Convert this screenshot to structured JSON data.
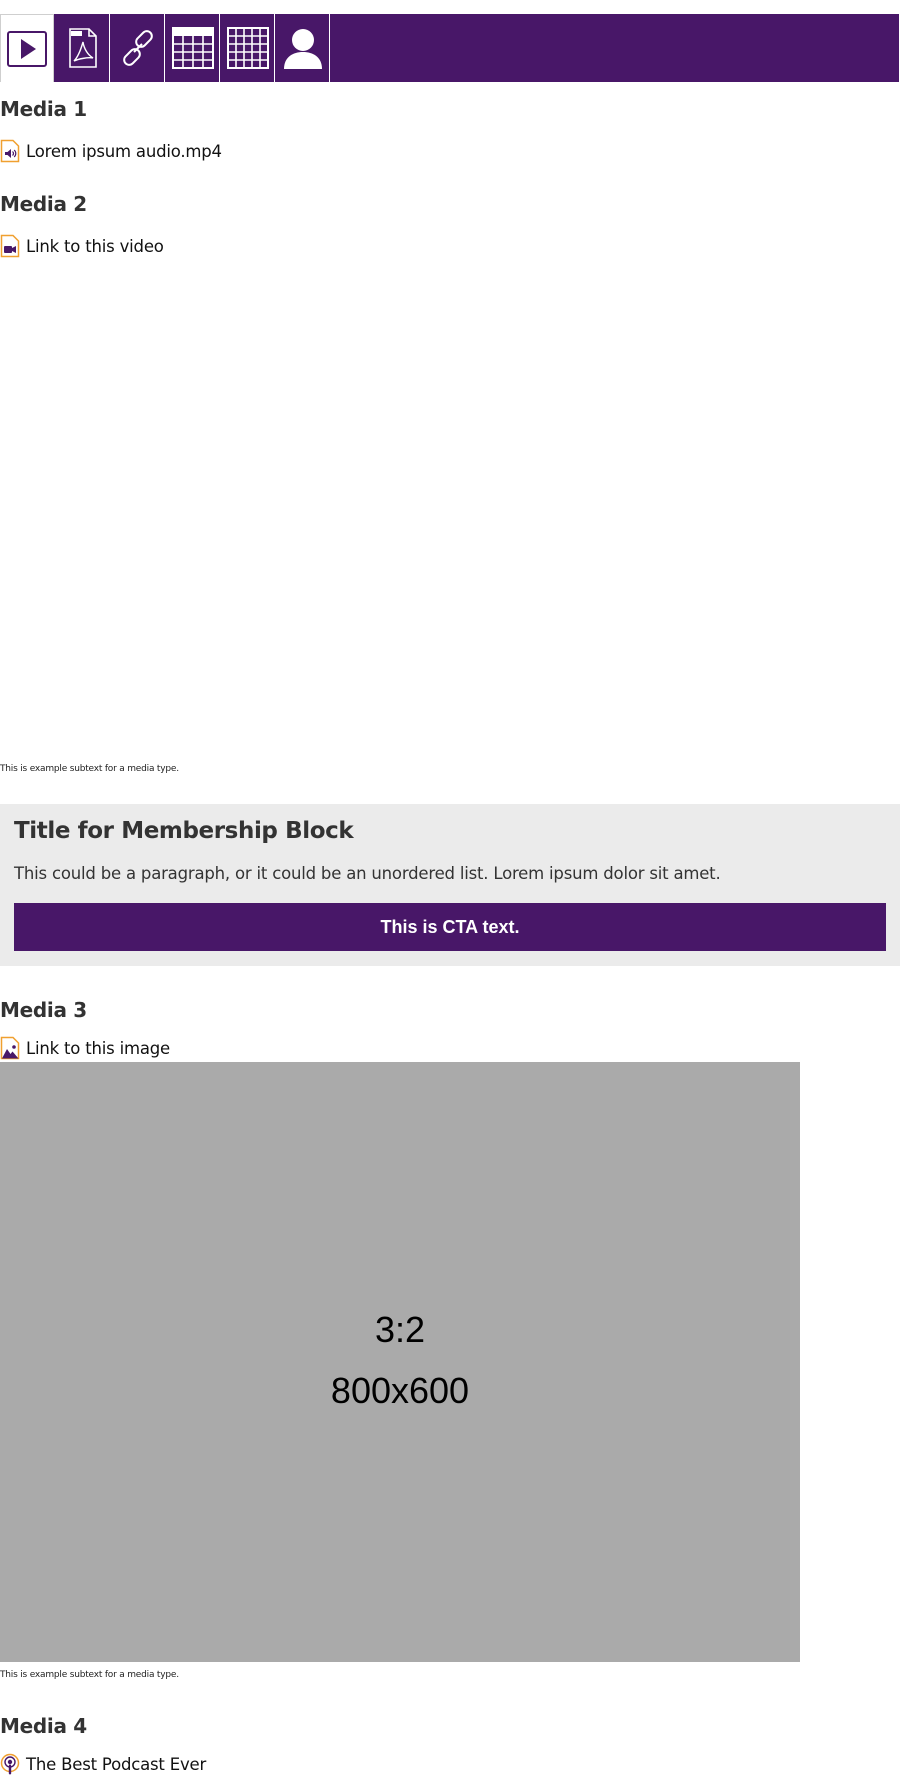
{
  "toolbar": {
    "tabs": [
      {
        "icon": "play-icon",
        "active": true
      },
      {
        "icon": "pdf-icon",
        "active": false
      },
      {
        "icon": "link-icon",
        "active": false
      },
      {
        "icon": "table-icon",
        "active": false
      },
      {
        "icon": "grid-icon",
        "active": false
      },
      {
        "icon": "person-icon",
        "active": false
      }
    ],
    "color": "#481768"
  },
  "media1": {
    "heading": "Media 1",
    "link_text": "Lorem ipsum audio.mp4",
    "icon": "audio-file-icon"
  },
  "media2": {
    "heading": "Media 2",
    "link_text": "Link to this video",
    "icon": "video-file-icon",
    "subtext": "This is example subtext for a media type."
  },
  "membership": {
    "title": "Title for Membership Block",
    "paragraph": "This could be a paragraph, or it could be an unordered list. Lorem ipsum dolor sit amet.",
    "cta": "This is CTA text.",
    "background": "#ebebeb",
    "cta_color": "#481768"
  },
  "media3": {
    "heading": "Media 3",
    "link_text": "Link to this image",
    "icon": "image-file-icon",
    "placeholder_ratio": "3:2",
    "placeholder_size": "800x600",
    "subtext": "This is example subtext for a media type."
  },
  "media4": {
    "heading": "Media 4",
    "link_text": "The Best Podcast Ever",
    "icon": "podcast-icon"
  }
}
